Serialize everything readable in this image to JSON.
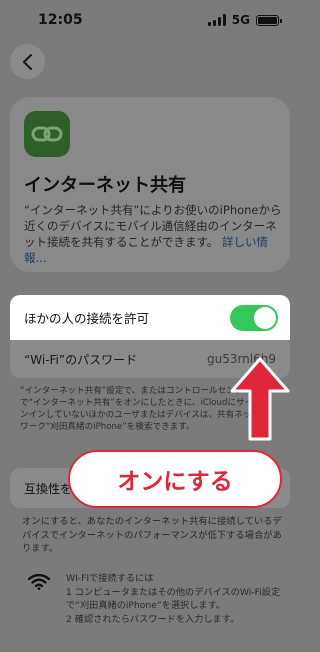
{
  "status": {
    "time": "12:05",
    "network": "5G"
  },
  "hero": {
    "title": "インターネット共有",
    "description": "“インターネット共有”によりお使いのiPhoneから近くのデバイスにモバイル通信経由のインターネット接続を共有することができます。",
    "link": "詳しい情報..."
  },
  "allow": {
    "label": "ほかの人の接続を許可",
    "enabled": true
  },
  "password": {
    "label": "“Wi-Fi”のパスワード",
    "value": "gu53rnl6h9"
  },
  "note": "“インターネット共有”設定で、またはコントロールセンターで“インターネット共有”をオンにしたときに、iCloudにサインインしていないほかのユーザまたはデバイスは、共有ネットワーク“刈田真緒のiPhone”を検索できます。",
  "compat": {
    "label": "互換性を"
  },
  "compat_desc": "オンにすると、あなたのインターネット共有に接続しているデバイスでインターネットのパフォーマンスが低下する場合があります。",
  "wifi_help": {
    "title": "WI-FIで接続するには",
    "step1": "1 コンピュータまたはその他のデバイスのWi-Fi設定で“刈田真緒のiPhone”を選択します。",
    "step2": "2 確認されたらパスワードを入力します。"
  },
  "callout": {
    "text": "オンにする"
  },
  "colors": {
    "accent_red": "#e0263a",
    "toggle_green": "#34c759"
  }
}
